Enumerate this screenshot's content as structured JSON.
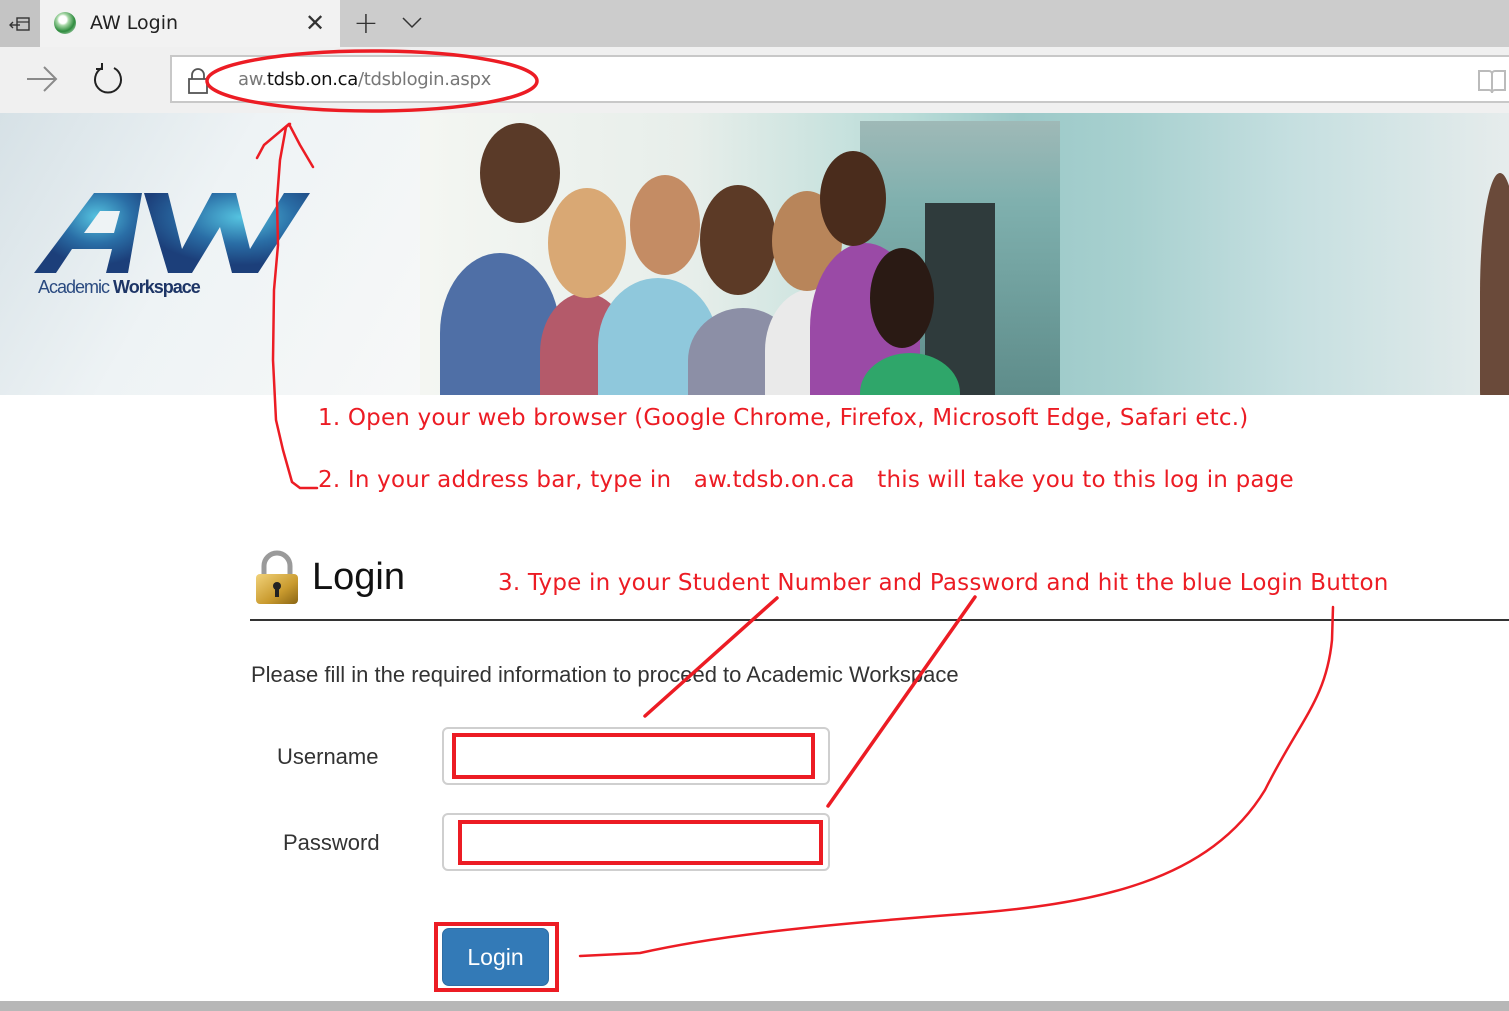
{
  "browser": {
    "tab": {
      "title": "AW Login",
      "favicon": "globe-icon",
      "close_icon": "close-icon"
    },
    "new_tab_icon": "plus-icon",
    "tab_list_icon": "chevron-down-icon",
    "set_aside_icon": "set-tabs-aside-icon",
    "nav": {
      "forward_icon": "arrow-right-icon",
      "refresh_icon": "refresh-icon"
    },
    "address_bar": {
      "lock_icon": "lock-icon",
      "url_prefix": "aw.",
      "url_host": "tdsb.on.ca",
      "url_path": "/tdsblogin.aspx",
      "reading_view_icon": "reading-view-icon"
    }
  },
  "banner": {
    "logo_mark": "AW",
    "logo_sub_light": "Academic",
    "logo_sub_bold": "Workspace",
    "photo_description": "group of smiling students in school hallway"
  },
  "instructions": {
    "step1": "1. Open your web browser (Google Chrome, Firefox, Microsoft Edge, Safari etc.)",
    "step2": "2. In your address bar, type in   aw.tdsb.on.ca   this will take you to this log in page",
    "step3": "3. Type in your Student Number and Password and hit the blue Login Button",
    "color": "#ec1c24"
  },
  "login": {
    "icon": "padlock-icon",
    "title": "Login",
    "intro": "Please fill in the required information to proceed to Academic Workspace",
    "username_label": "Username",
    "username_value": "",
    "password_label": "Password",
    "password_value": "",
    "submit_label": "Login",
    "button_color": "#337ab7"
  }
}
